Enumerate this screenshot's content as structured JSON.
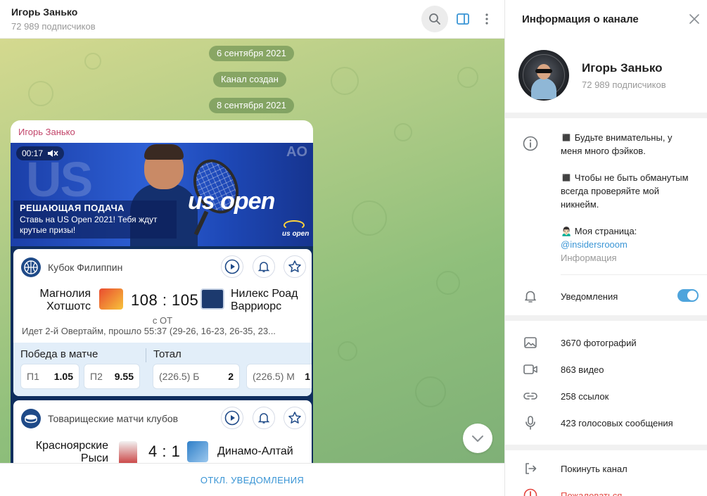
{
  "chat": {
    "title": "Игорь Занько",
    "subtitle": "72 989 подписчиков",
    "date1": "6 сентября 2021",
    "created": "Канал создан",
    "date2": "8 сентября 2021",
    "post": {
      "author": "Игорь Занько",
      "video_time": "00:17",
      "banner_bg_text": "US",
      "banner_ao": "AO",
      "banner_logo": "us open",
      "banner_logo_small": "us open",
      "promo_title": "РЕШАЮЩАЯ ПОДАЧА",
      "promo_text": "Ставь на US Open 2021! Тебя ждут крутые призы!"
    },
    "matches": [
      {
        "league": "Кубок Филиппин",
        "team_home": "Магнолия Хотшотс",
        "team_away": "Нилекс Роад Варриорс",
        "score": "108 : 105",
        "status": "с ОТ",
        "info": "Идет 2-й Овертайм, прошло 55:37 (29-26, 16-23, 26-35, 23...",
        "market1": "Победа в матче",
        "market2": "Тотал",
        "odds": [
          {
            "k": "П1",
            "v": "1.05"
          },
          {
            "k": "П2",
            "v": "9.55"
          },
          {
            "k": "(226.5) Б",
            "v": "2"
          },
          {
            "k": "(226.5) М",
            "v": "1"
          }
        ]
      },
      {
        "league": "Товарищеские матчи клубов",
        "team_home": "Красноярские Рыси",
        "team_away": "Динамо-Алтай",
        "score": "4 : 1"
      }
    ],
    "bottom_action": "ОТКЛ. УВЕДОМЛЕНИЯ"
  },
  "info": {
    "title": "Информация о канале",
    "name": "Игорь Занько",
    "subs": "72 989 подписчиков",
    "desc1": "◼️ Будьте внимательны, у меня много фэйков.",
    "desc2": "◼️ Чтобы не быть обманутым всегда проверяйте мой никнейм.",
    "desc3_label": "🙍🏻‍♂️ Моя страница:",
    "desc3_link": "@insidersrooom",
    "desc_caption": "Информация",
    "notifications": "Уведомления",
    "notifications_on": true,
    "media": [
      {
        "icon": "photo-icon",
        "label": "3670 фотографий"
      },
      {
        "icon": "video-icon",
        "label": "863 видео"
      },
      {
        "icon": "link-icon",
        "label": "258 ссылок"
      },
      {
        "icon": "mic-icon",
        "label": "423 голосовых сообщения"
      }
    ],
    "leave": "Покинуть канал",
    "report": "Пожаловаться"
  },
  "colors": {
    "accent": "#3a95d5",
    "author": "#c2456a",
    "danger": "#e4453f",
    "toggle": "#4ea4dc"
  }
}
